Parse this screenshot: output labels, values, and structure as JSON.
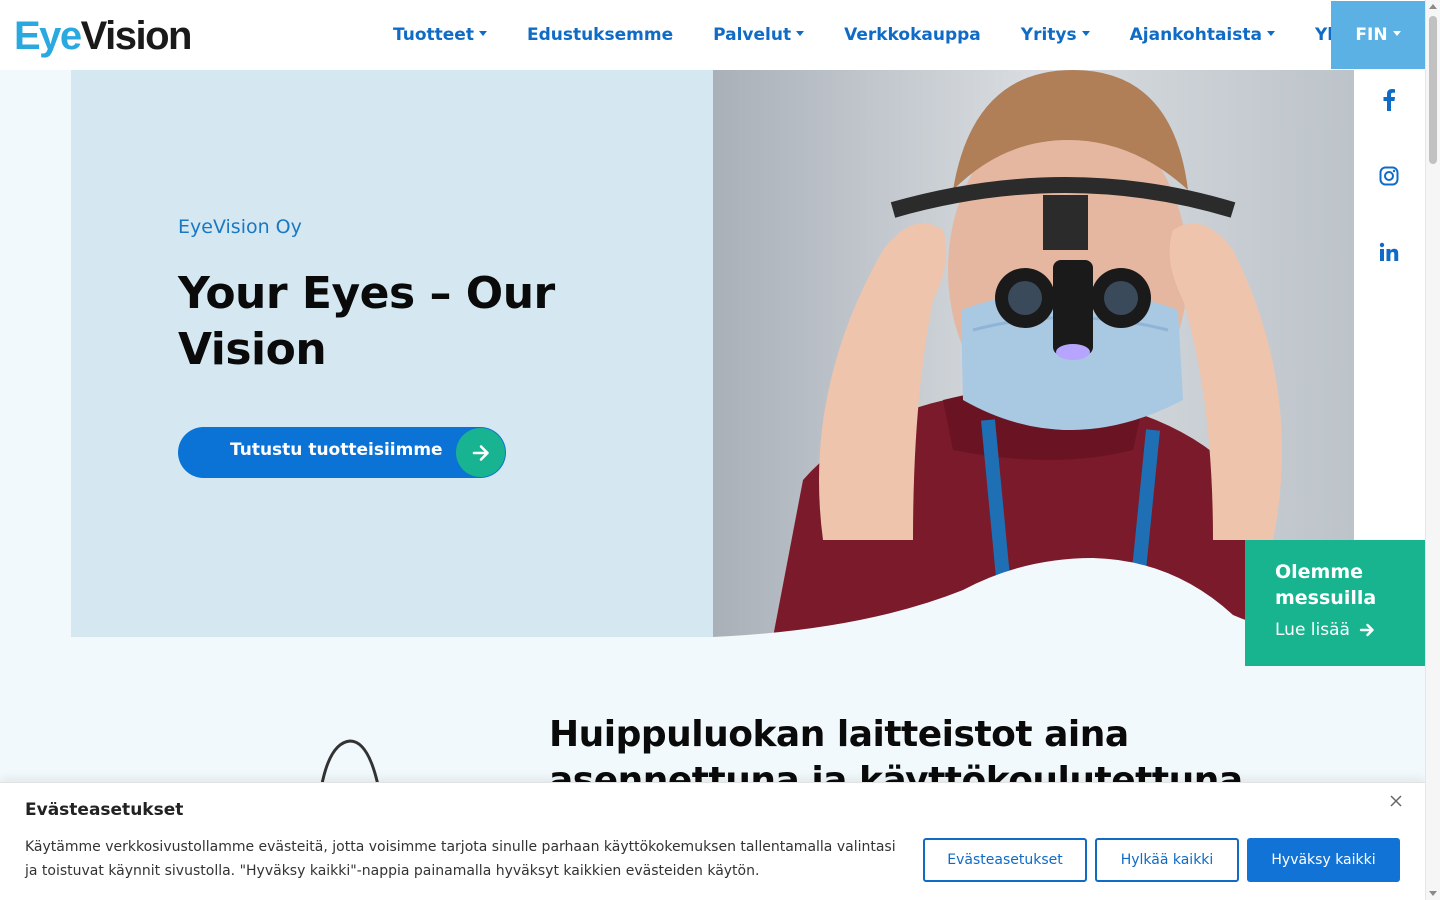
{
  "logo": {
    "part1": "Eye",
    "part2": "Vision"
  },
  "nav": {
    "items": [
      {
        "label": "Tuotteet",
        "dropdown": true
      },
      {
        "label": "Edustuksemme",
        "dropdown": false
      },
      {
        "label": "Palvelut",
        "dropdown": true
      },
      {
        "label": "Verkkokauppa",
        "dropdown": false
      },
      {
        "label": "Yritys",
        "dropdown": true
      },
      {
        "label": "Ajankohtaista",
        "dropdown": true
      },
      {
        "label": "Yhteys",
        "dropdown": false
      }
    ],
    "language": "FIN"
  },
  "hero": {
    "subtitle": "EyeVision Oy",
    "title": "Your Eyes – Our Vision",
    "cta_label": "Tutustu tuotteisiimme"
  },
  "social": [
    "facebook-icon",
    "instagram-icon",
    "linkedin-icon"
  ],
  "fair_box": {
    "title": "Olemme messuilla",
    "link": "Lue lisää"
  },
  "section2": {
    "title": "Huippuluokan laitteistot aina asennettuna ja käyttökoulutettuna"
  },
  "cookie": {
    "title": "Evästeasetukset",
    "text": "Käytämme verkkosivustollamme evästeitä, jotta voisimme tarjota sinulle parhaan käyttökokemuksen tallentamalla valintasi ja toistuvat käynnit sivustolla. \"Hyväksy kaikki\"-nappia painamalla hyväksyt kaikkien evästeiden käytön.",
    "settings_button": "Evästeasetukset",
    "reject_button": "Hylkää kaikki",
    "accept_button": "Hyväksy kaikki"
  },
  "colors": {
    "brand_blue": "#0f6bc6",
    "accent_green": "#17b48f",
    "hero_bg": "#d5e8f2",
    "lang_bg": "#5bb1e4"
  }
}
